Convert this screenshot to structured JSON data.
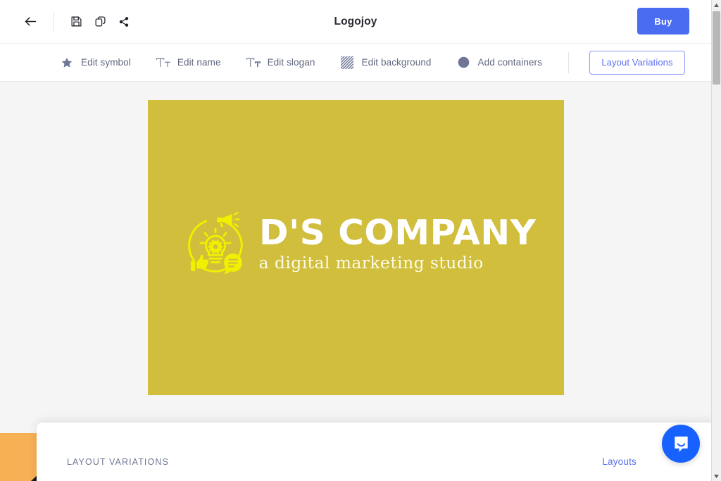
{
  "window": {
    "title": "Logojoy"
  },
  "topbar": {
    "back_icon": "arrow-left-icon",
    "save_icon": "save-floppy-icon",
    "duplicate_icon": "duplicate-icon",
    "share_icon": "share-icon",
    "title": "Logojoy",
    "buy_label": "Buy"
  },
  "toolbar": {
    "items": [
      {
        "label": "Edit symbol",
        "icon": "star-icon"
      },
      {
        "label": "Edit name",
        "icon": "text-large-icon"
      },
      {
        "label": "Edit slogan",
        "icon": "text-small-icon"
      },
      {
        "label": "Edit background",
        "icon": "diagonal-stripes-icon"
      },
      {
        "label": "Add containers",
        "icon": "circle-icon"
      }
    ],
    "layout_variations_label": "Layout Variations"
  },
  "canvas": {
    "background_color": "#f5f5f5",
    "logo": {
      "card_color": "#d0be3c",
      "name": "D'S COMPANY",
      "slogan": "a digital marketing studio",
      "name_color": "#ffffff",
      "slogan_color": "#fdfbe8",
      "mark_color": "#f0f000",
      "mark_icon": "lightbulb-gear-megaphone-thumbsup-chat-icon"
    }
  },
  "bottom_panel": {
    "title": "LAYOUT VARIATIONS",
    "link_label": "Layouts",
    "thumbnails": [
      {
        "name": "variation-thumb-orange",
        "color": "#f8b055"
      },
      {
        "name": "variation-thumb-yellow",
        "color": "#e8f000"
      }
    ]
  },
  "chat": {
    "icon": "intercom-chat-icon",
    "color": "#1761ff"
  },
  "colors": {
    "accent_blue": "#4a6cf0",
    "link_blue": "#5a6ef2",
    "toolbar_text": "#61667f",
    "logo_yellow": "#d0be3c"
  }
}
